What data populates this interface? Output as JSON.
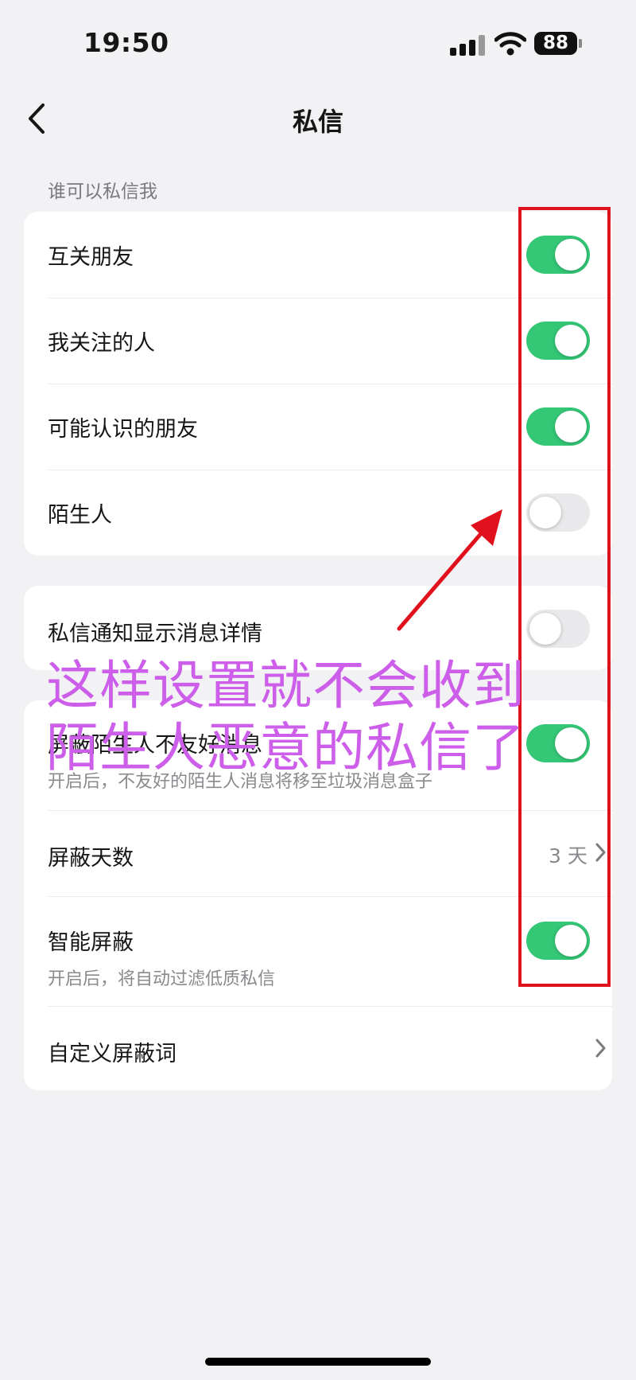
{
  "status_bar": {
    "time": "19:50",
    "battery": "88"
  },
  "nav": {
    "title": "私信"
  },
  "who_can_message": {
    "section_label": "谁可以私信我",
    "items": [
      {
        "label": "互关朋友",
        "enabled": true
      },
      {
        "label": "我关注的人",
        "enabled": true
      },
      {
        "label": "可能认识的朋友",
        "enabled": true
      },
      {
        "label": "陌生人",
        "enabled": false
      }
    ]
  },
  "notification": {
    "label": "私信通知显示消息详情",
    "enabled": false
  },
  "block": {
    "unfriendly": {
      "label": "屏蔽陌生人不友好消息",
      "sub": "开启后，不友好的陌生人消息将移至垃圾消息盒子",
      "enabled": true
    },
    "days": {
      "label": "屏蔽天数",
      "value": "3 天"
    },
    "smart": {
      "label": "智能屏蔽",
      "sub": "开启后，将自动过滤低质私信",
      "enabled": true
    },
    "custom_words": {
      "label": "自定义屏蔽词"
    }
  },
  "annotation": {
    "line1": "这样设置就不会收到",
    "line2": "陌生人恶意的私信了",
    "text_color": "#CC5EEA",
    "box_color": "#E0101C"
  },
  "colors": {
    "toggle_on": "#34C776",
    "toggle_off": "#E9E9EB",
    "background": "#F2F2F4"
  }
}
